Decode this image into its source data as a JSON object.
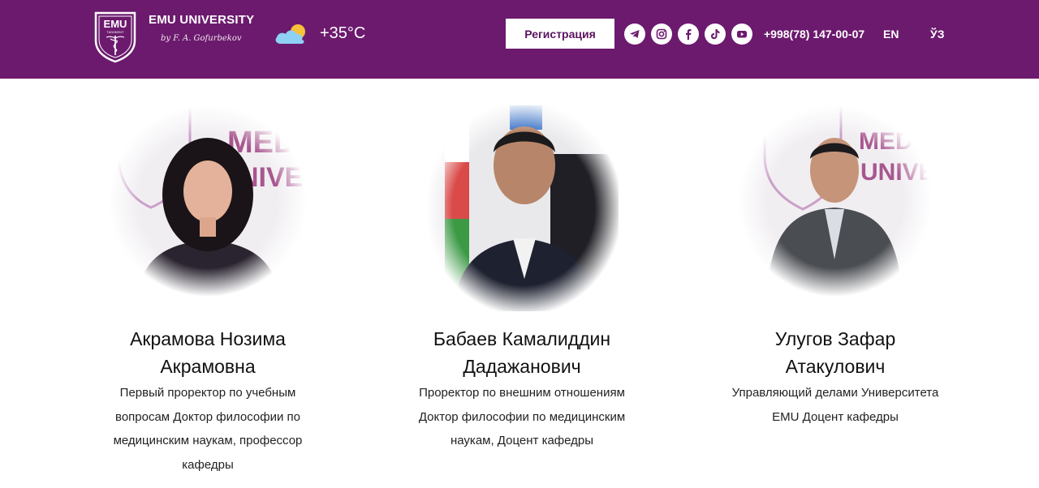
{
  "header": {
    "logo_text": "EMU",
    "logo_subtext": "TASHKENT",
    "brand_title": "EMU UNIVERSITY",
    "brand_signature": "by F. A. Gofurbekov",
    "weather_icon": "cloud-sun-icon",
    "temperature": "+35°C",
    "register_label": "Регистрация",
    "social_icons": [
      "telegram-icon",
      "instagram-icon",
      "facebook-icon",
      "tiktok-icon",
      "youtube-icon"
    ],
    "phone": "+998(78) 147-00-07",
    "lang_en": "EN",
    "lang_uz": "ЎЗ",
    "colors": {
      "header_bg": "#6c1a6e",
      "button_text": "#5b1560"
    }
  },
  "people": [
    {
      "name_line1": "Акрамова Нозима",
      "name_line2": "Акрамовна",
      "role_lines": [
        "Первый проректор по учебным",
        "вопросам Доктор философии по",
        "медицинским наукам, профессор",
        "кафедры"
      ]
    },
    {
      "name_line1": "Бабаев Камалиддин",
      "name_line2": "Дадажанович",
      "role_lines": [
        "Проректор по внешним отношениям",
        "Доктор философии по медицинским",
        "наукам, Доцент кафедры"
      ]
    },
    {
      "name_line1": "Улугов Зафар",
      "name_line2": "Атакулович",
      "role_lines": [
        "Управляющий делами Университета",
        "EMU Доцент кафедры"
      ]
    }
  ]
}
